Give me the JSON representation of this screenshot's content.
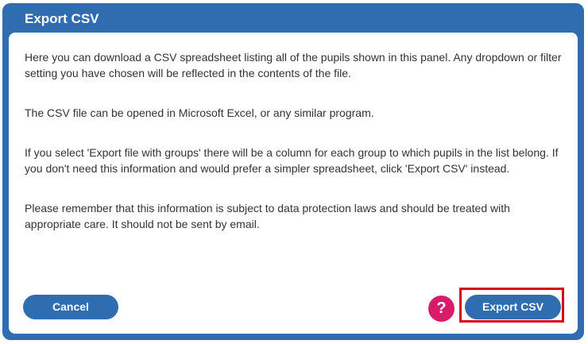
{
  "dialog": {
    "title": "Export CSV",
    "paragraphs": [
      "Here you can download a CSV spreadsheet listing all of the pupils shown in this panel. Any dropdown or filter setting you have chosen will be reflected in the contents of the file.",
      "The CSV file can be opened in Microsoft Excel, or any similar program.",
      "If you select 'Export file with groups' there will be a column for each group to which pupils in the list belong. If you don't need this information and would prefer a simpler spreadsheet, click 'Export CSV' instead.",
      "Please remember that this information is subject to data protection laws and should be treated with appropriate care. It should not be sent by email."
    ]
  },
  "buttons": {
    "cancel": "Cancel",
    "help": "?",
    "export": "Export CSV"
  },
  "colors": {
    "primary": "#2f6cb0",
    "help": "#d81b6a",
    "highlight": "#d9001b"
  },
  "icons": {
    "help": "question-mark-icon"
  }
}
